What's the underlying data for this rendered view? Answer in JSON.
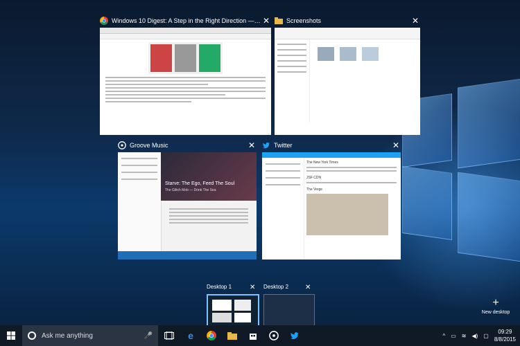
{
  "windows": [
    {
      "id": "chrome",
      "title": "Windows 10 Digest: A Step in the Right Direction — Tariq Yusuf ...",
      "icon": "chrome-icon"
    },
    {
      "id": "explorer",
      "title": "Screenshots",
      "icon": "folder-icon"
    },
    {
      "id": "groove",
      "title": "Groove Music",
      "icon": "groove-icon"
    },
    {
      "id": "twitter",
      "title": "Twitter",
      "icon": "twitter-icon"
    }
  ],
  "groove": {
    "album_title": "Starve: The Ego, Feed The Soul",
    "album_sub": "The Glitch Mob — Drink The Sea"
  },
  "twitter": {
    "account": "The New York Times",
    "account2": "JSF CDN",
    "account3": "The Verge"
  },
  "desktops": [
    {
      "label": "Desktop 1",
      "active": true
    },
    {
      "label": "Desktop 2",
      "active": false
    }
  ],
  "new_desktop_label": "New desktop",
  "taskbar": {
    "search_placeholder": "Ask me anything",
    "time": "09:29",
    "date": "8/8/2015",
    "pinned": [
      "edge-icon",
      "chrome-icon",
      "file-explorer-icon",
      "store-icon",
      "groove-icon",
      "twitter-icon"
    ]
  },
  "colors": {
    "accent": "#1da1f2",
    "taskbar": "#0f1a26"
  }
}
